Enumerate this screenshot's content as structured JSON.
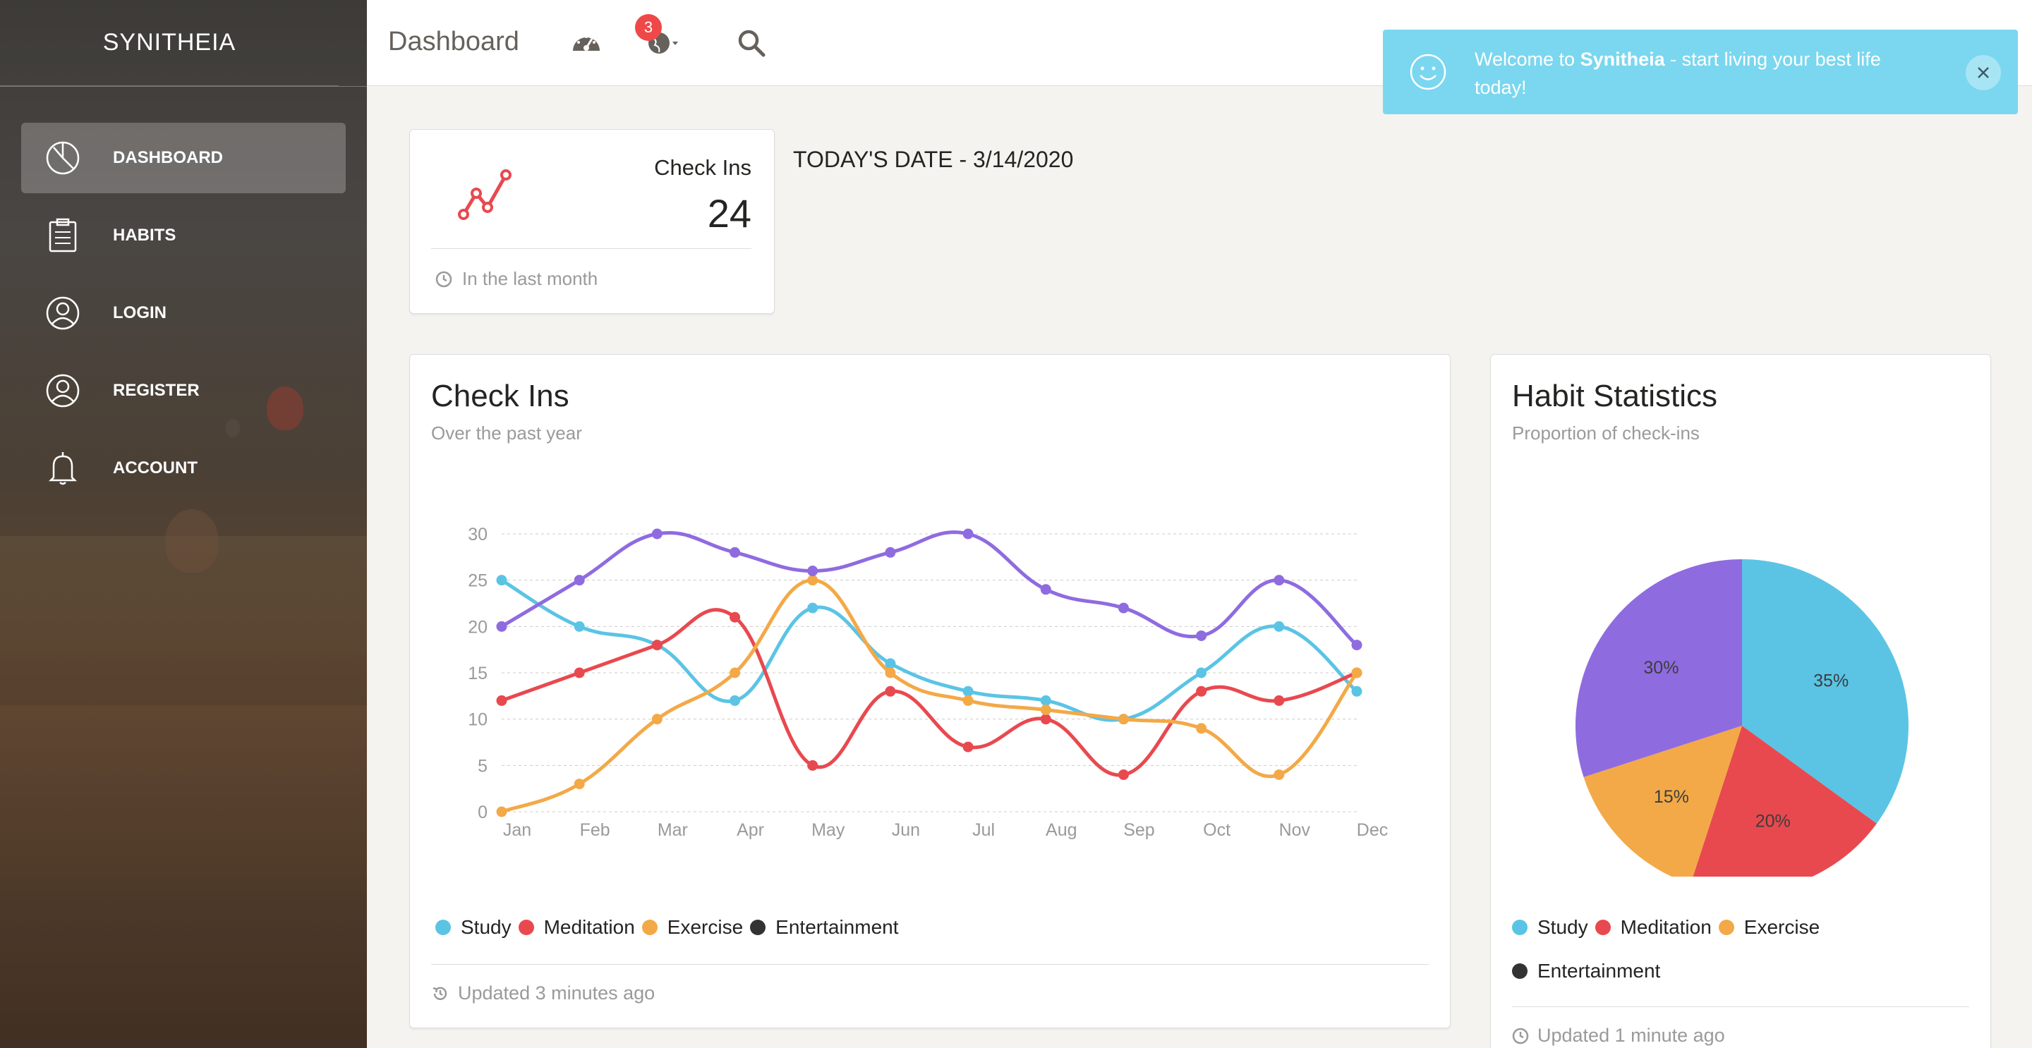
{
  "brand": "SYNITHEIA",
  "nav": [
    {
      "label": "DASHBOARD",
      "icon": "pie-chart-icon",
      "active": true
    },
    {
      "label": "HABITS",
      "icon": "clipboard-icon",
      "active": false
    },
    {
      "label": "LOGIN",
      "icon": "user-circle-icon",
      "active": false
    },
    {
      "label": "REGISTER",
      "icon": "user-circle-icon",
      "active": false
    },
    {
      "label": "ACCOUNT",
      "icon": "bell-icon",
      "active": false
    }
  ],
  "topbar": {
    "title": "Dashboard",
    "notification_count": "3",
    "icons": [
      "speedometer-icon",
      "globe-icon",
      "search-icon"
    ]
  },
  "notification": {
    "prefix": "Welcome to ",
    "brand": "Synitheia",
    "suffix": " - start living your best life today!"
  },
  "stat_card": {
    "label": "Check Ins",
    "value": "24",
    "footer": "In the last month"
  },
  "today": "TODAY'S DATE - 3/14/2020",
  "line_card": {
    "title": "Check Ins",
    "subtitle": "Over the past year",
    "footer": "Updated 3 minutes ago"
  },
  "pie_card": {
    "title": "Habit Statistics",
    "subtitle": "Proportion of check-ins",
    "footer": "Updated 1 minute ago"
  },
  "legend": [
    {
      "name": "Study",
      "color": "#5bc4e5"
    },
    {
      "name": "Meditation",
      "color": "#e8494f"
    },
    {
      "name": "Exercise",
      "color": "#f3a947"
    },
    {
      "name": "Entertainment",
      "color": "#333333"
    }
  ],
  "chart_data": [
    {
      "type": "line",
      "x": [
        "Jan",
        "Feb",
        "Mar",
        "Apr",
        "May",
        "Jun",
        "Jul",
        "Aug",
        "Sep",
        "Oct",
        "Nov",
        "Dec"
      ],
      "yticks": [
        0,
        5,
        10,
        15,
        20,
        25,
        30
      ],
      "ylim": [
        0,
        30
      ],
      "grid": true,
      "series": [
        {
          "color": "#5bc4e5",
          "values": [
            25,
            20,
            18,
            12,
            22,
            16,
            13,
            12,
            10,
            15,
            20,
            13
          ]
        },
        {
          "color": "#e8494f",
          "values": [
            12,
            15,
            18,
            21,
            5,
            13,
            7,
            10,
            4,
            13,
            12,
            15
          ]
        },
        {
          "color": "#f3a947",
          "values": [
            0,
            3,
            10,
            15,
            25,
            15,
            12,
            11,
            10,
            9,
            4,
            15
          ]
        },
        {
          "color": "#8f6be0",
          "values": [
            20,
            25,
            30,
            28,
            26,
            28,
            30,
            24,
            22,
            19,
            25,
            18
          ]
        }
      ]
    },
    {
      "type": "pie",
      "slices": [
        {
          "label": "35%",
          "value": 35,
          "color": "#5bc4e5"
        },
        {
          "label": "20%",
          "value": 20,
          "color": "#e8494f"
        },
        {
          "label": "15%",
          "value": 15,
          "color": "#f3a947"
        },
        {
          "label": "30%",
          "value": 30,
          "color": "#8f6be0"
        }
      ]
    }
  ]
}
